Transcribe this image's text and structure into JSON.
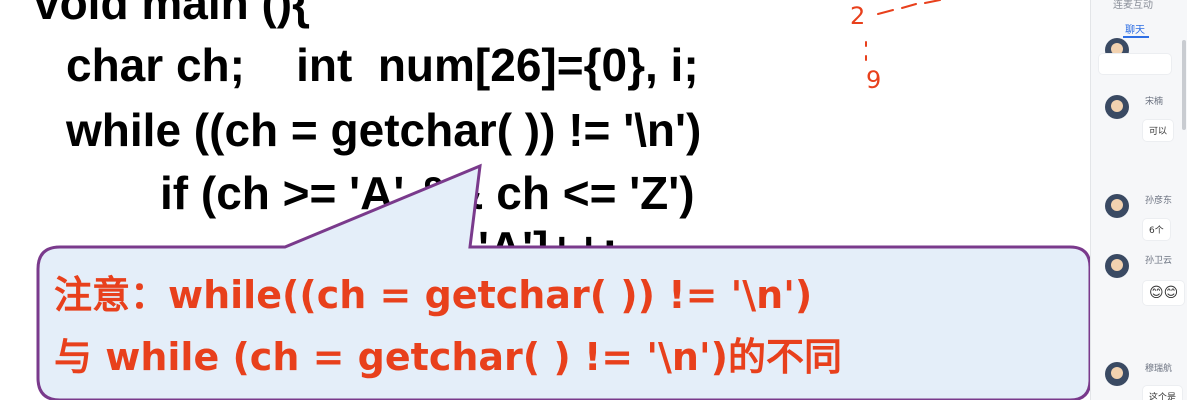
{
  "slide": {
    "code_lines": [
      "void main (){",
      "char ch;    int  num[26]={0}, i;",
      "while ((ch = getchar( )) != '\\n')",
      "if (ch >= 'A' && ch <= 'Z')",
      "'A']++;"
    ],
    "annotations": {
      "digit_2": "2",
      "digit_9": "9"
    },
    "callout": {
      "line1": "注意：while((ch = getchar( )) != '\\n')",
      "line2": "与 while (ch = getchar( ) != '\\n')的不同"
    }
  },
  "chat": {
    "header_truncated": "连麦互动",
    "active_tab": "聊天",
    "messages": [
      {
        "user": "",
        "text": ""
      },
      {
        "user": "宋楠",
        "text": "可以"
      },
      {
        "user": "孙彦东",
        "text": "6个"
      },
      {
        "user": "孙卫云",
        "text": "😊😊"
      },
      {
        "user": "穆瑞航",
        "text": "这个是"
      }
    ]
  },
  "colors": {
    "annotation_red": "#e8401c",
    "callout_fill": "#e4eef9",
    "callout_border": "#7a3a8c",
    "chat_accent": "#2f6fe4"
  }
}
